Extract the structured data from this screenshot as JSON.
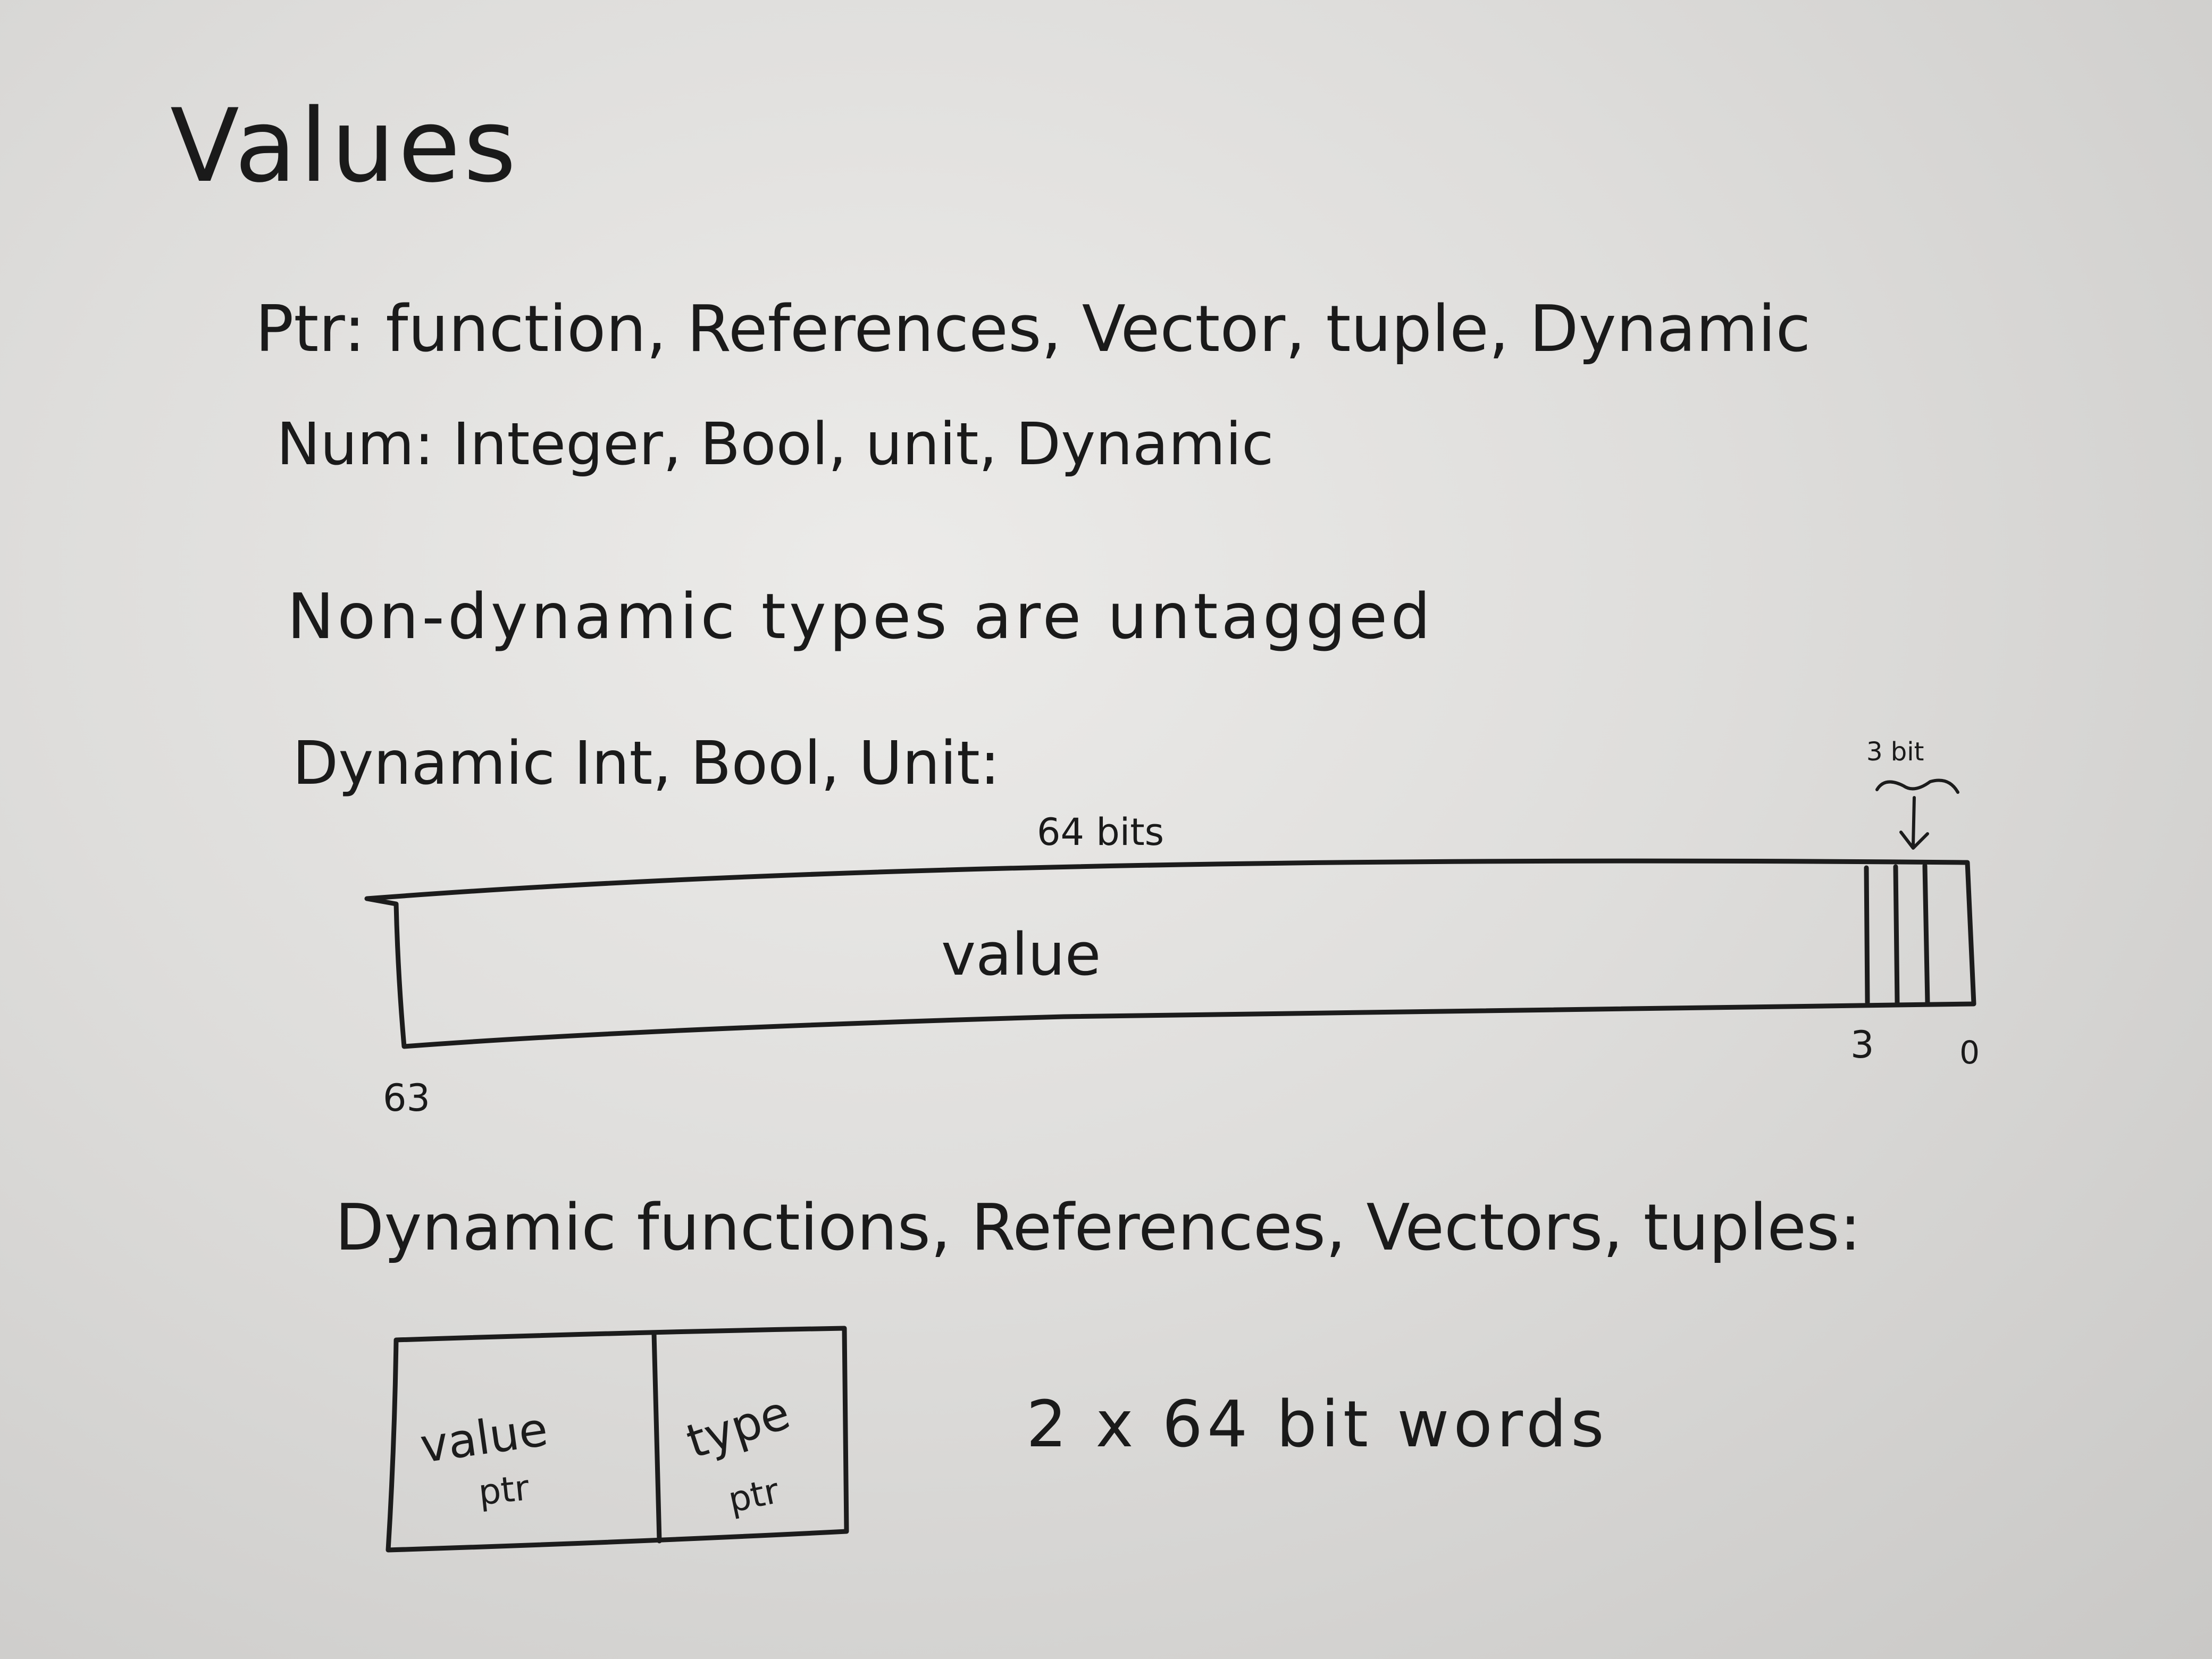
{
  "title": "Values",
  "ptr_line": "Ptr: function, References, Vector, tuple, Dynamic",
  "num_line": "Num: Integer, Bool, unit, Dynamic",
  "untagged_line": "Non-dynamic types are untagged",
  "dynamic_int_heading": "Dynamic Int, Bool, Unit:",
  "word_layout": {
    "width_label": "64 bits",
    "tag_width_label": "3 bit",
    "field_label": "value",
    "high_bit": "63",
    "tag_start_bit": "3",
    "low_bit": "0"
  },
  "dynamic_ptr_heading": "Dynamic functions, References, Vectors, tuples:",
  "pair_layout": {
    "cells": [
      {
        "top": "value",
        "bottom": "ptr"
      },
      {
        "top": "type",
        "bottom": "ptr"
      }
    ],
    "size_label": "2 x 64 bit words"
  }
}
